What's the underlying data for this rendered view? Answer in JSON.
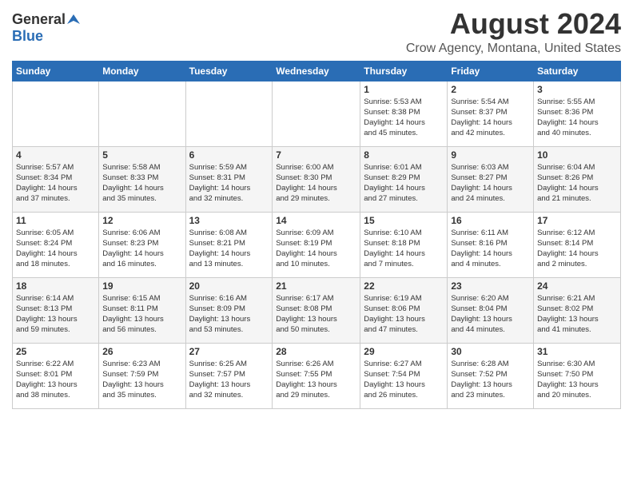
{
  "header": {
    "logo_general": "General",
    "logo_blue": "Blue",
    "month_year": "August 2024",
    "location": "Crow Agency, Montana, United States"
  },
  "days_of_week": [
    "Sunday",
    "Monday",
    "Tuesday",
    "Wednesday",
    "Thursday",
    "Friday",
    "Saturday"
  ],
  "weeks": [
    [
      {
        "day": "",
        "info": ""
      },
      {
        "day": "",
        "info": ""
      },
      {
        "day": "",
        "info": ""
      },
      {
        "day": "",
        "info": ""
      },
      {
        "day": "1",
        "info": "Sunrise: 5:53 AM\nSunset: 8:38 PM\nDaylight: 14 hours\nand 45 minutes."
      },
      {
        "day": "2",
        "info": "Sunrise: 5:54 AM\nSunset: 8:37 PM\nDaylight: 14 hours\nand 42 minutes."
      },
      {
        "day": "3",
        "info": "Sunrise: 5:55 AM\nSunset: 8:36 PM\nDaylight: 14 hours\nand 40 minutes."
      }
    ],
    [
      {
        "day": "4",
        "info": "Sunrise: 5:57 AM\nSunset: 8:34 PM\nDaylight: 14 hours\nand 37 minutes."
      },
      {
        "day": "5",
        "info": "Sunrise: 5:58 AM\nSunset: 8:33 PM\nDaylight: 14 hours\nand 35 minutes."
      },
      {
        "day": "6",
        "info": "Sunrise: 5:59 AM\nSunset: 8:31 PM\nDaylight: 14 hours\nand 32 minutes."
      },
      {
        "day": "7",
        "info": "Sunrise: 6:00 AM\nSunset: 8:30 PM\nDaylight: 14 hours\nand 29 minutes."
      },
      {
        "day": "8",
        "info": "Sunrise: 6:01 AM\nSunset: 8:29 PM\nDaylight: 14 hours\nand 27 minutes."
      },
      {
        "day": "9",
        "info": "Sunrise: 6:03 AM\nSunset: 8:27 PM\nDaylight: 14 hours\nand 24 minutes."
      },
      {
        "day": "10",
        "info": "Sunrise: 6:04 AM\nSunset: 8:26 PM\nDaylight: 14 hours\nand 21 minutes."
      }
    ],
    [
      {
        "day": "11",
        "info": "Sunrise: 6:05 AM\nSunset: 8:24 PM\nDaylight: 14 hours\nand 18 minutes."
      },
      {
        "day": "12",
        "info": "Sunrise: 6:06 AM\nSunset: 8:23 PM\nDaylight: 14 hours\nand 16 minutes."
      },
      {
        "day": "13",
        "info": "Sunrise: 6:08 AM\nSunset: 8:21 PM\nDaylight: 14 hours\nand 13 minutes."
      },
      {
        "day": "14",
        "info": "Sunrise: 6:09 AM\nSunset: 8:19 PM\nDaylight: 14 hours\nand 10 minutes."
      },
      {
        "day": "15",
        "info": "Sunrise: 6:10 AM\nSunset: 8:18 PM\nDaylight: 14 hours\nand 7 minutes."
      },
      {
        "day": "16",
        "info": "Sunrise: 6:11 AM\nSunset: 8:16 PM\nDaylight: 14 hours\nand 4 minutes."
      },
      {
        "day": "17",
        "info": "Sunrise: 6:12 AM\nSunset: 8:14 PM\nDaylight: 14 hours\nand 2 minutes."
      }
    ],
    [
      {
        "day": "18",
        "info": "Sunrise: 6:14 AM\nSunset: 8:13 PM\nDaylight: 13 hours\nand 59 minutes."
      },
      {
        "day": "19",
        "info": "Sunrise: 6:15 AM\nSunset: 8:11 PM\nDaylight: 13 hours\nand 56 minutes."
      },
      {
        "day": "20",
        "info": "Sunrise: 6:16 AM\nSunset: 8:09 PM\nDaylight: 13 hours\nand 53 minutes."
      },
      {
        "day": "21",
        "info": "Sunrise: 6:17 AM\nSunset: 8:08 PM\nDaylight: 13 hours\nand 50 minutes."
      },
      {
        "day": "22",
        "info": "Sunrise: 6:19 AM\nSunset: 8:06 PM\nDaylight: 13 hours\nand 47 minutes."
      },
      {
        "day": "23",
        "info": "Sunrise: 6:20 AM\nSunset: 8:04 PM\nDaylight: 13 hours\nand 44 minutes."
      },
      {
        "day": "24",
        "info": "Sunrise: 6:21 AM\nSunset: 8:02 PM\nDaylight: 13 hours\nand 41 minutes."
      }
    ],
    [
      {
        "day": "25",
        "info": "Sunrise: 6:22 AM\nSunset: 8:01 PM\nDaylight: 13 hours\nand 38 minutes."
      },
      {
        "day": "26",
        "info": "Sunrise: 6:23 AM\nSunset: 7:59 PM\nDaylight: 13 hours\nand 35 minutes."
      },
      {
        "day": "27",
        "info": "Sunrise: 6:25 AM\nSunset: 7:57 PM\nDaylight: 13 hours\nand 32 minutes."
      },
      {
        "day": "28",
        "info": "Sunrise: 6:26 AM\nSunset: 7:55 PM\nDaylight: 13 hours\nand 29 minutes."
      },
      {
        "day": "29",
        "info": "Sunrise: 6:27 AM\nSunset: 7:54 PM\nDaylight: 13 hours\nand 26 minutes."
      },
      {
        "day": "30",
        "info": "Sunrise: 6:28 AM\nSunset: 7:52 PM\nDaylight: 13 hours\nand 23 minutes."
      },
      {
        "day": "31",
        "info": "Sunrise: 6:30 AM\nSunset: 7:50 PM\nDaylight: 13 hours\nand 20 minutes."
      }
    ]
  ]
}
